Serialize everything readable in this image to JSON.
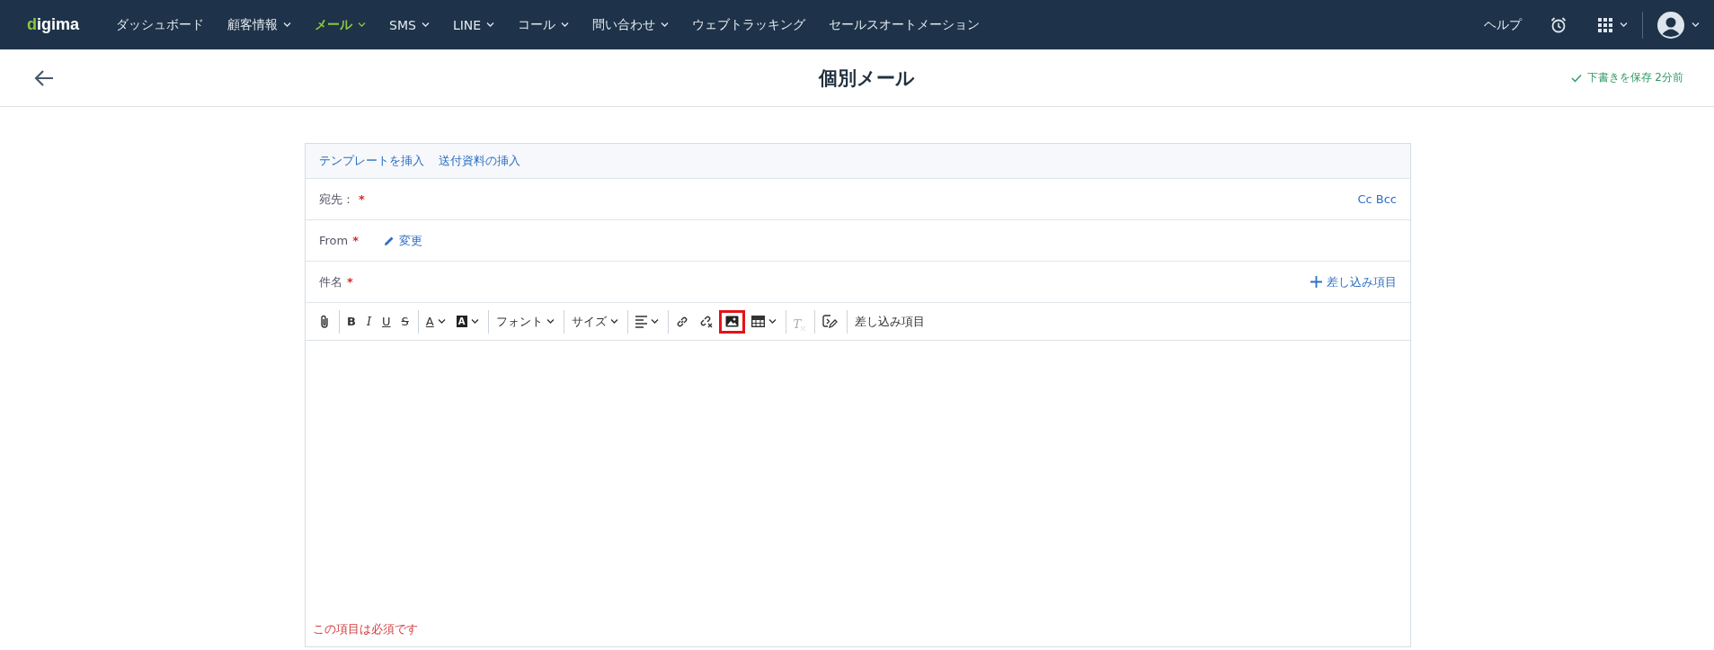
{
  "nav": {
    "logo": "digima",
    "items": [
      {
        "label": "ダッシュボード",
        "selected": false,
        "dropdown": false
      },
      {
        "label": "顧客情報",
        "selected": false,
        "dropdown": true
      },
      {
        "label": "メール",
        "selected": true,
        "dropdown": true
      },
      {
        "label": "SMS",
        "selected": false,
        "dropdown": true
      },
      {
        "label": "LINE",
        "selected": false,
        "dropdown": true
      },
      {
        "label": "コール",
        "selected": false,
        "dropdown": true
      },
      {
        "label": "問い合わせ",
        "selected": false,
        "dropdown": true
      },
      {
        "label": "ウェブトラッキング",
        "selected": false,
        "dropdown": false
      },
      {
        "label": "セールスオートメーション",
        "selected": false,
        "dropdown": false
      }
    ],
    "help": "ヘルプ"
  },
  "header": {
    "title": "個別メール",
    "save_status": "下書きを保存 2分前"
  },
  "compose": {
    "links": [
      "テンプレートを挿入",
      "送付資料の挿入"
    ],
    "fields": [
      {
        "kind": "to",
        "label": "宛先：",
        "required_mark": "*",
        "action": "Cc Bcc"
      },
      {
        "kind": "from",
        "label": "From",
        "required_mark": "*",
        "edit": "変更"
      },
      {
        "kind": "subject",
        "label": "件名",
        "required_mark": "*",
        "action": "差し込み項目"
      }
    ],
    "toolbar": [
      {
        "kind": "attach",
        "sep": false,
        "dropdown": false,
        "highlighted": false,
        "disabled": false
      },
      {
        "kind": "bold",
        "label": "B",
        "sep": true,
        "dropdown": false,
        "highlighted": false,
        "disabled": false
      },
      {
        "kind": "italic",
        "label": "I",
        "sep": false,
        "dropdown": false,
        "highlighted": false,
        "disabled": false
      },
      {
        "kind": "underline",
        "label": "U",
        "sep": false,
        "dropdown": false,
        "highlighted": false,
        "disabled": false
      },
      {
        "kind": "strike",
        "label": "S",
        "sep": false,
        "dropdown": false,
        "highlighted": false,
        "disabled": false
      },
      {
        "kind": "fontcolor",
        "label": "A",
        "sep": true,
        "dropdown": true,
        "highlighted": false,
        "disabled": false
      },
      {
        "kind": "highlight",
        "label": "A",
        "sep": false,
        "dropdown": true,
        "highlighted": false,
        "disabled": false
      },
      {
        "kind": "text",
        "label": "フォント",
        "sep": true,
        "dropdown": true,
        "highlighted": false,
        "disabled": false
      },
      {
        "kind": "text",
        "label": "サイズ",
        "sep": true,
        "dropdown": true,
        "highlighted": false,
        "disabled": false
      },
      {
        "kind": "align",
        "sep": true,
        "dropdown": true,
        "highlighted": false,
        "disabled": false
      },
      {
        "kind": "link",
        "sep": true,
        "dropdown": false,
        "highlighted": false,
        "disabled": false
      },
      {
        "kind": "unlink",
        "sep": false,
        "dropdown": false,
        "highlighted": false,
        "disabled": false
      },
      {
        "kind": "image",
        "sep": false,
        "dropdown": false,
        "highlighted": true,
        "disabled": false
      },
      {
        "kind": "table",
        "sep": false,
        "dropdown": true,
        "highlighted": false,
        "disabled": false
      },
      {
        "kind": "clearformat",
        "label": "T",
        "sep": true,
        "dropdown": false,
        "highlighted": false,
        "disabled": true
      },
      {
        "kind": "merge",
        "sep": true,
        "dropdown": false,
        "highlighted": false,
        "disabled": false
      },
      {
        "kind": "text",
        "label": "差し込み項目",
        "sep": true,
        "dropdown": false,
        "highlighted": false,
        "disabled": false
      }
    ],
    "error": "この項目は必須です"
  }
}
